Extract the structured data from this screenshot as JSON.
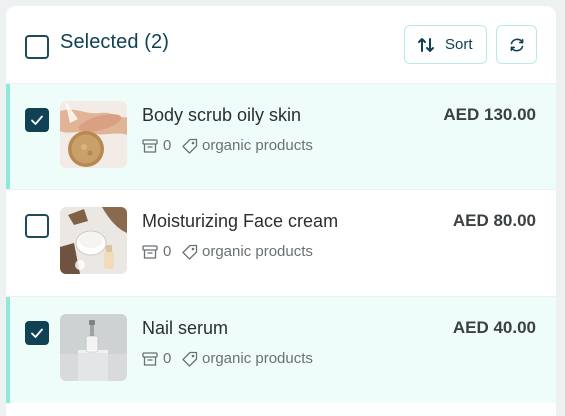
{
  "header": {
    "title": "Selected (2)",
    "sort_label": "Sort",
    "select_all_checked": false
  },
  "colors": {
    "primary": "#104154",
    "selected_row_bg": "#effdfa",
    "selected_row_accent": "#8ee9d6",
    "button_border": "#b8ebe3"
  },
  "products": [
    {
      "name": "Body scrub oily skin",
      "price": "AED 130.00",
      "stock": "0",
      "category": "organic products",
      "checked": true
    },
    {
      "name": "Moisturizing Face cream",
      "price": "AED 80.00",
      "stock": "0",
      "category": "organic products",
      "checked": false
    },
    {
      "name": "Nail serum",
      "price": "AED 40.00",
      "stock": "0",
      "category": "organic products",
      "checked": true
    }
  ],
  "icons": {
    "sort": "sort-arrows-icon",
    "refresh": "refresh-icon",
    "stock": "box-icon",
    "category": "tag-icon",
    "check": "checkmark-icon"
  }
}
